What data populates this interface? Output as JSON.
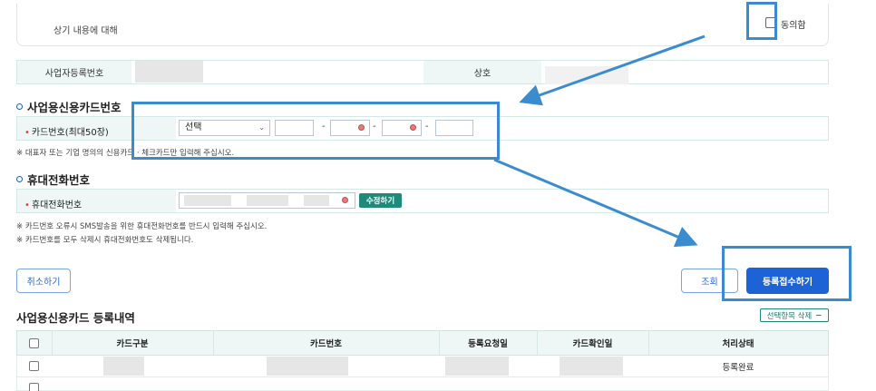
{
  "consent": {
    "label": "상기 내용에 대해",
    "agree_text": "동의함"
  },
  "business": {
    "reg_no_label": "사업자등록번호",
    "company_label": "상호"
  },
  "card_section": {
    "title": "사업용신용카드번호",
    "card_label": "카드번호(최대50장)",
    "select_value": "선택",
    "notice": "※ 대표자 또는 기업 명의의 신용카드 · 체크카드만 입력해 주십시오.",
    "dash": "-"
  },
  "phone_section": {
    "title": "휴대전화번호",
    "phone_label": "휴대전화번호",
    "edit_button": "수정하기",
    "notice_1": "※ 카드번호 오류시 SMS발송을 위한 휴대전화번호를 반드시 입력해 주십시오.",
    "notice_2": "※ 카드번호를 모두 삭제시 휴대전화번호도 삭제됩니다."
  },
  "actions": {
    "cancel": "취소하기",
    "search": "조회",
    "submit": "등록접수하기"
  },
  "list": {
    "title": "사업용신용카드 등록내역",
    "delete_selected": "선택항목 삭제",
    "columns": [
      "카드구분",
      "카드번호",
      "등록요청일",
      "카드확인일",
      "처리상태"
    ],
    "rows": [
      {
        "status": "등록완료"
      }
    ]
  },
  "colors": {
    "accent": "#1f8a7a",
    "primary": "#1e63d6",
    "highlight": "#3b8ccf"
  }
}
